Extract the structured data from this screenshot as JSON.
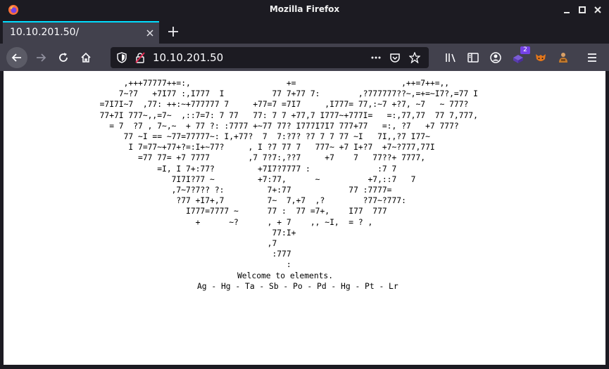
{
  "window": {
    "title": "Mozilla Firefox",
    "icons": [
      "firefox-icon",
      "minimize-icon",
      "maximize-icon",
      "close-icon"
    ]
  },
  "tab": {
    "label": "10.10.201.50/"
  },
  "urlbar": {
    "url": "10.10.201.50"
  },
  "toolbar": {
    "badge_count": "2"
  },
  "colors": {
    "tab_accent": "#00ddff",
    "chrome_dark": "#1c1b22",
    "chrome_mid": "#42414d",
    "page_bg": "#ffffff"
  },
  "page": {
    "ascii_art": "       ,+++77777++=:,                    +=                      ,++=7++=,,\n      7~?7   +7I77 :,I777  I          77 7+77 7:        ,?777777??~,=+=~I7?,=77 I\n  =7I7I~7  ,77: ++:~+777777 7     +77=7 =7I7     ,I777= 77,:~7 +?7, ~7   ~ 777?\n  77+7I 777~,,=7~  ,::7=7: 7 77   77: 7 7 +77,7 I777~+777I=   =:,77,77  77 7,777,\n    = 7  ?7 , 7~,~  + 77 ?: :7777 +~77 77? I777I7I7 777+77   =:, ?7   +7 777?\n       77 ~I == ~77=77777~: I,+77?  7  7:?7? ?7 7 7 77 ~I   7I,,?7 I77~\n        I 7=77~+77+?=:I+~77?     , I ?7 77 7   777~ +7 I+?7  +7~?777,77I\n          =77 77= +7 7777        ,7 7?7:,??7     +7    7   77??+ 7777,\n              =I, I 7+:77?         +7I7?7777 :              :7 7\n                 7I7I?77 ~         +7:77,      ~          +7,::7   7\n                 ,7~7?7?? ?:         7+:77            77 :7777=\n                  ?77 +I7+,7         7~  7,+7  ,?        ?77~?777:\n                    I777=7777 ~      77 :  77 =7+,    I77  777\n                      +      ~?      , + 7    ,, ~I,  = ? ,\n                                      77:I+\n                                     ,7\n                                      :777\n                                         :",
    "welcome": "Welcome to elements.",
    "elements_line": "Ag - Hg - Ta - Sb - Po - Pd - Hg - Pt - Lr"
  }
}
